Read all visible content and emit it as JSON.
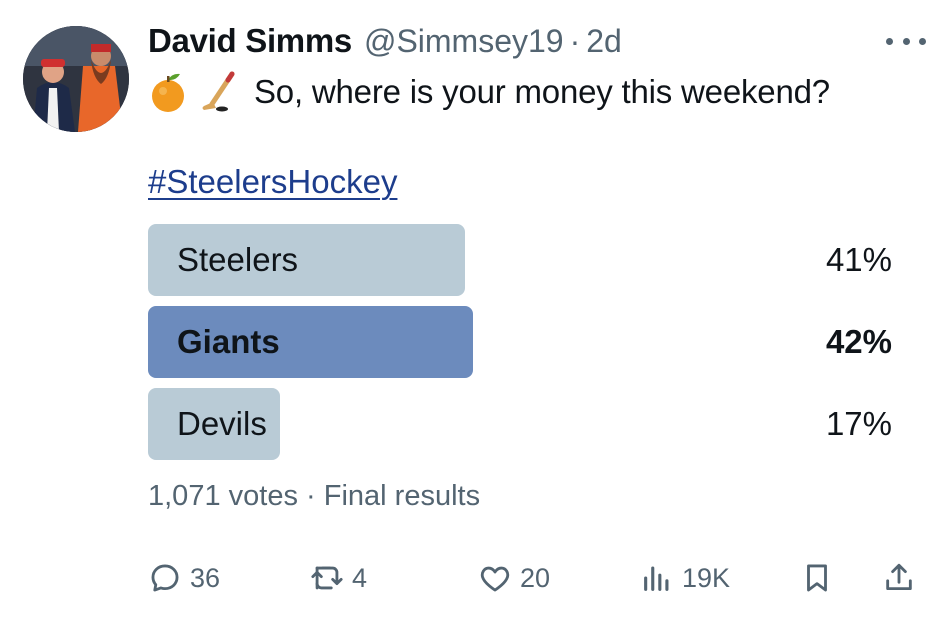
{
  "author": {
    "name": "David Simms",
    "handle": "@Simmsey19",
    "separator": "·",
    "time": "2d"
  },
  "tweet": {
    "emojis": [
      "orange-emoji",
      "hockey-stick-emoji"
    ],
    "text": "So, where is your money this weekend?",
    "hashtag": "#SteelersHockey"
  },
  "poll": {
    "options": [
      {
        "label": "Steelers",
        "percent": "41%",
        "fraction": 0.41,
        "winner": false
      },
      {
        "label": "Giants",
        "percent": "42%",
        "fraction": 0.42,
        "winner": true
      },
      {
        "label": "Devils",
        "percent": "17%",
        "fraction": 0.17,
        "winner": false
      }
    ],
    "votes": "1,071 votes",
    "status_sep": "·",
    "status": "Final results"
  },
  "actions": {
    "replies": "36",
    "retweets": "4",
    "likes": "20",
    "views": "19K"
  },
  "icons": [
    "more-icon",
    "reply-icon",
    "retweet-icon",
    "like-icon",
    "views-icon",
    "bookmark-icon",
    "share-icon"
  ],
  "colors": {
    "winner_bar": "#6c8bbd",
    "bar": "#b9cbd6",
    "muted": "#536471",
    "link": "#1d3d8c"
  }
}
